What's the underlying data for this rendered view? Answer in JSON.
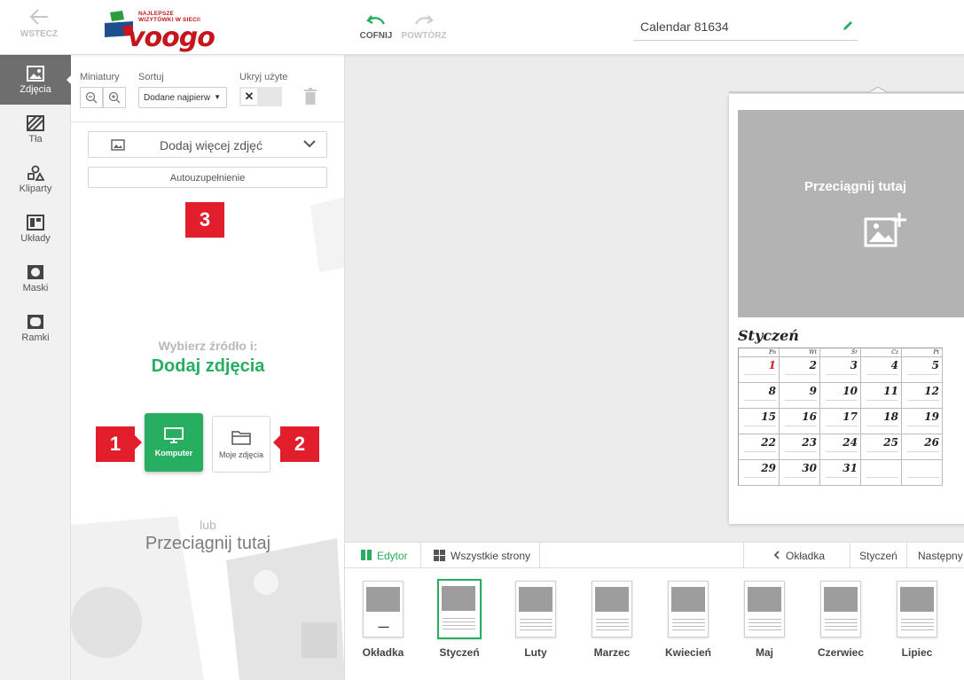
{
  "topbar": {
    "back_label": "WSTECZ",
    "logo_tagline": "NAJLEPSZE WIZYTÓWKI W SIECI!",
    "logo_word": "voogo",
    "undo_label": "COFNIJ",
    "redo_label": "POWTÓRZ",
    "project_title": "Calendar 81634"
  },
  "sidebar": {
    "items": [
      {
        "label": "Zdjęcia",
        "icon": "image-icon"
      },
      {
        "label": "Tła",
        "icon": "background-icon"
      },
      {
        "label": "Kliparty",
        "icon": "shapes-icon"
      },
      {
        "label": "Układy",
        "icon": "layout-icon"
      },
      {
        "label": "Maski",
        "icon": "mask-icon"
      },
      {
        "label": "Ramki",
        "icon": "frame-icon"
      }
    ]
  },
  "panel": {
    "thumbs_label": "Miniatury",
    "sort_label": "Sortuj",
    "sort_value": "Dodane najpierw",
    "hide_used_label": "Ukryj użyte",
    "add_more_label": "Dodaj więcej zdjęć",
    "autofill_label": "Autouzupełnienie",
    "source_hint": "Wybierz źródło i:",
    "source_title": "Dodaj zdjęcia",
    "computer_label": "Komputer",
    "my_photos_label": "Moje zdjęcia",
    "or_label": "lub",
    "drag_label": "Przeciągnij tutaj",
    "badges": [
      "1",
      "2",
      "3"
    ]
  },
  "canvas": {
    "drop_label": "Przeciągnij tutaj",
    "month": "Styczeń",
    "weekdays": [
      "Pn",
      "Wt",
      "Śr",
      "Cz",
      "Pt"
    ],
    "days": [
      [
        "1",
        "2",
        "3",
        "4",
        "5"
      ],
      [
        "8",
        "9",
        "10",
        "11",
        "12"
      ],
      [
        "15",
        "16",
        "17",
        "18",
        "19"
      ],
      [
        "22",
        "23",
        "24",
        "25",
        "26"
      ],
      [
        "29",
        "30",
        "31",
        "",
        ""
      ]
    ]
  },
  "bottom_bar": {
    "editor_label": "Edytor",
    "all_pages_label": "Wszystkie strony",
    "prev_label": "Okładka",
    "current_label": "Styczeń",
    "next_label": "Następny"
  },
  "thumbnails": [
    "Okładka",
    "Styczeń",
    "Luty",
    "Marzec",
    "Kwiecień",
    "Maj",
    "Czerwiec",
    "Lipiec"
  ],
  "colors": {
    "accent": "#27ae60",
    "badge": "#e21d2c",
    "brand_red": "#c4161c",
    "brand_blue": "#1d4e8f"
  }
}
